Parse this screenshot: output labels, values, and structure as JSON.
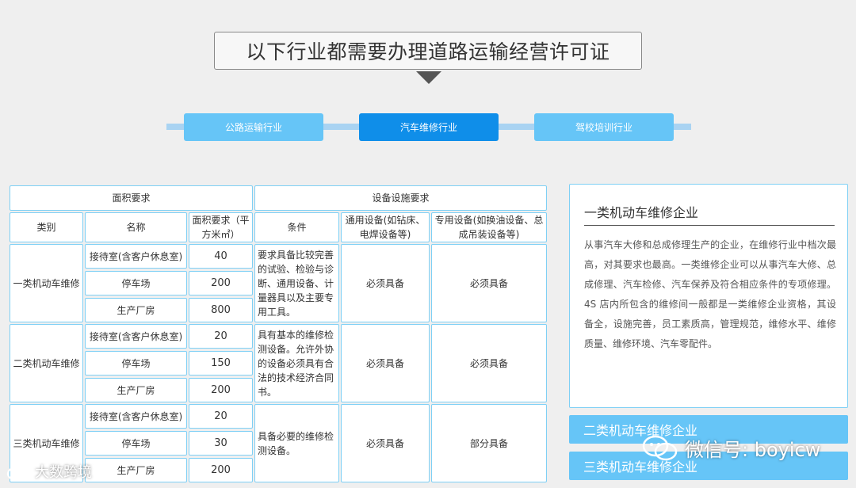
{
  "header": {
    "title": "以下行业都需要办理道路运输经营许可证"
  },
  "tabs": [
    {
      "label": "公路运输行业",
      "active": false
    },
    {
      "label": "汽车维修行业",
      "active": true
    },
    {
      "label": "驾校培训行业",
      "active": false
    }
  ],
  "table": {
    "group_area": "面积要求",
    "group_equipment": "设备设施要求",
    "headers": {
      "category": "类别",
      "name": "名称",
      "area": "面积要求（平方米㎡）",
      "condition": "条件",
      "general": "通用设备(如钻床、电焊设备等)",
      "special": "专用设备(如换油设备、总成吊装设备等)"
    },
    "rows": [
      {
        "category": "一类机动车维修",
        "items": [
          {
            "name": "接待室(含客户休息室)",
            "area": "40"
          },
          {
            "name": "停车场",
            "area": "200"
          },
          {
            "name": "生产厂房",
            "area": "800"
          }
        ],
        "condition": "要求具备比较完善的试验、检验与诊断、通用设备、计量器具以及主要专用工具。",
        "general": "必须具备",
        "special": "必须具备"
      },
      {
        "category": "二类机动车维修",
        "items": [
          {
            "name": "接待室(含客户休息室)",
            "area": "20"
          },
          {
            "name": "停车场",
            "area": "150"
          },
          {
            "name": "生产厂房",
            "area": "200"
          }
        ],
        "condition": "具有基本的维修检测设备。允许外协的设备必须具有合法的技术经济合同书。",
        "general": "必须具备",
        "special": "必须具备"
      },
      {
        "category": "三类机动车维修",
        "items": [
          {
            "name": "接待室(含客户休息室)",
            "area": "20"
          },
          {
            "name": "停车场",
            "area": "30"
          },
          {
            "name": "生产厂房",
            "area": "200"
          }
        ],
        "condition": "具备必要的维修检测设备。",
        "general": "必须具备",
        "special": "部分具备"
      }
    ]
  },
  "panel": {
    "title": "一类机动车维修企业",
    "body": "从事汽车大修和总成修理生产的企业，在维修行业中档次最高，对其要求也最高。一类维修企业可以从事汽车大修、总成修理、汽车检修、汽车保养及符合相应条件的专项修理。4S 店内所包含的维修间一般都是一类维修企业资格，其设备全，设施完善，员工素质高，管理规范，维修水平、维修质量、维修环境、汽车零配件。",
    "buttons": [
      "二类机动车维修企业",
      "三类机动车维修企业"
    ]
  },
  "watermarks": {
    "wechat": "微信号: boyicw",
    "left": "大数跨境"
  },
  "colors": {
    "accent_dark": "#0f8ee9",
    "accent_light": "#66c5f7",
    "border": "#7fd0f5"
  }
}
